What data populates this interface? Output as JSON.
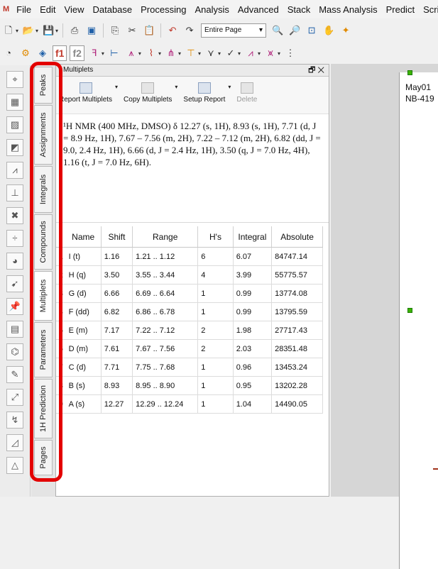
{
  "menubar": {
    "items": [
      "File",
      "Edit",
      "View",
      "Database",
      "Processing",
      "Analysis",
      "Advanced",
      "Stack",
      "Mass Analysis",
      "Predict",
      "Scrip"
    ]
  },
  "toolbar": {
    "page_select": "Entire Page",
    "f1_label": "f1",
    "f2_label": "f2"
  },
  "vertical_tabs": [
    "Peaks",
    "Assignments",
    "Integrals",
    "Compounds",
    "Multiplets",
    "Parameters",
    "1H Prediction",
    "Pages"
  ],
  "active_tab": "Multiplets",
  "panel": {
    "title": "Multiplets",
    "header_icons": "🗗 ✕",
    "buttons": {
      "report": "Report Multiplets",
      "copy": "Copy Multiplets",
      "setup": "Setup Report",
      "delete": "Delete"
    },
    "report_text": "¹H NMR (400 MHz, DMSO) δ 12.27 (s, 1H), 8.93 (s, 1H), 7.71 (d, J = 8.9 Hz, 1H), 7.67 – 7.56 (m, 2H), 7.22 – 7.12 (m, 2H), 6.82 (dd, J = 9.0, 2.4 Hz, 1H), 6.66 (d, J = 2.4 Hz, 1H), 3.50 (q, J = 7.0 Hz, 4H), 1.16 (t, J = 7.0 Hz, 6H).",
    "table": {
      "headers": [
        "Name",
        "Shift",
        "Range",
        "H's",
        "Integral",
        "Absolute"
      ],
      "rows": [
        {
          "n": "1",
          "name": "I (t)",
          "shift": "1.16",
          "range": "1.21 .. 1.12",
          "hs": "6",
          "integral": "6.07",
          "absolute": "84747.14"
        },
        {
          "n": "2",
          "name": "H (q)",
          "shift": "3.50",
          "range": "3.55 .. 3.44",
          "hs": "4",
          "integral": "3.99",
          "absolute": "55775.57"
        },
        {
          "n": "3",
          "name": "G (d)",
          "shift": "6.66",
          "range": "6.69 .. 6.64",
          "hs": "1",
          "integral": "0.99",
          "absolute": "13774.08"
        },
        {
          "n": "4",
          "name": "F (dd)",
          "shift": "6.82",
          "range": "6.86 .. 6.78",
          "hs": "1",
          "integral": "0.99",
          "absolute": "13795.59"
        },
        {
          "n": "5",
          "name": "E (m)",
          "shift": "7.17",
          "range": "7.22 .. 7.12",
          "hs": "2",
          "integral": "1.98",
          "absolute": "27717.43"
        },
        {
          "n": "6",
          "name": "D (m)",
          "shift": "7.61",
          "range": "7.67 .. 7.56",
          "hs": "2",
          "integral": "2.03",
          "absolute": "28351.48"
        },
        {
          "n": "7",
          "name": "C (d)",
          "shift": "7.71",
          "range": "7.75 .. 7.68",
          "hs": "1",
          "integral": "0.96",
          "absolute": "13453.24"
        },
        {
          "n": "8",
          "name": "B (s)",
          "shift": "8.93",
          "range": "8.95 .. 8.90",
          "hs": "1",
          "integral": "0.95",
          "absolute": "13202.28"
        },
        {
          "n": "9",
          "name": "A (s)",
          "shift": "12.27",
          "range": "12.29 .. 12.24",
          "hs": "1",
          "integral": "1.04",
          "absolute": "14490.05"
        }
      ]
    }
  },
  "canvas": {
    "line1": "May01",
    "line2": "NB-419"
  },
  "colors": {
    "highlight": "#e30000",
    "handle": "#3cb300"
  }
}
